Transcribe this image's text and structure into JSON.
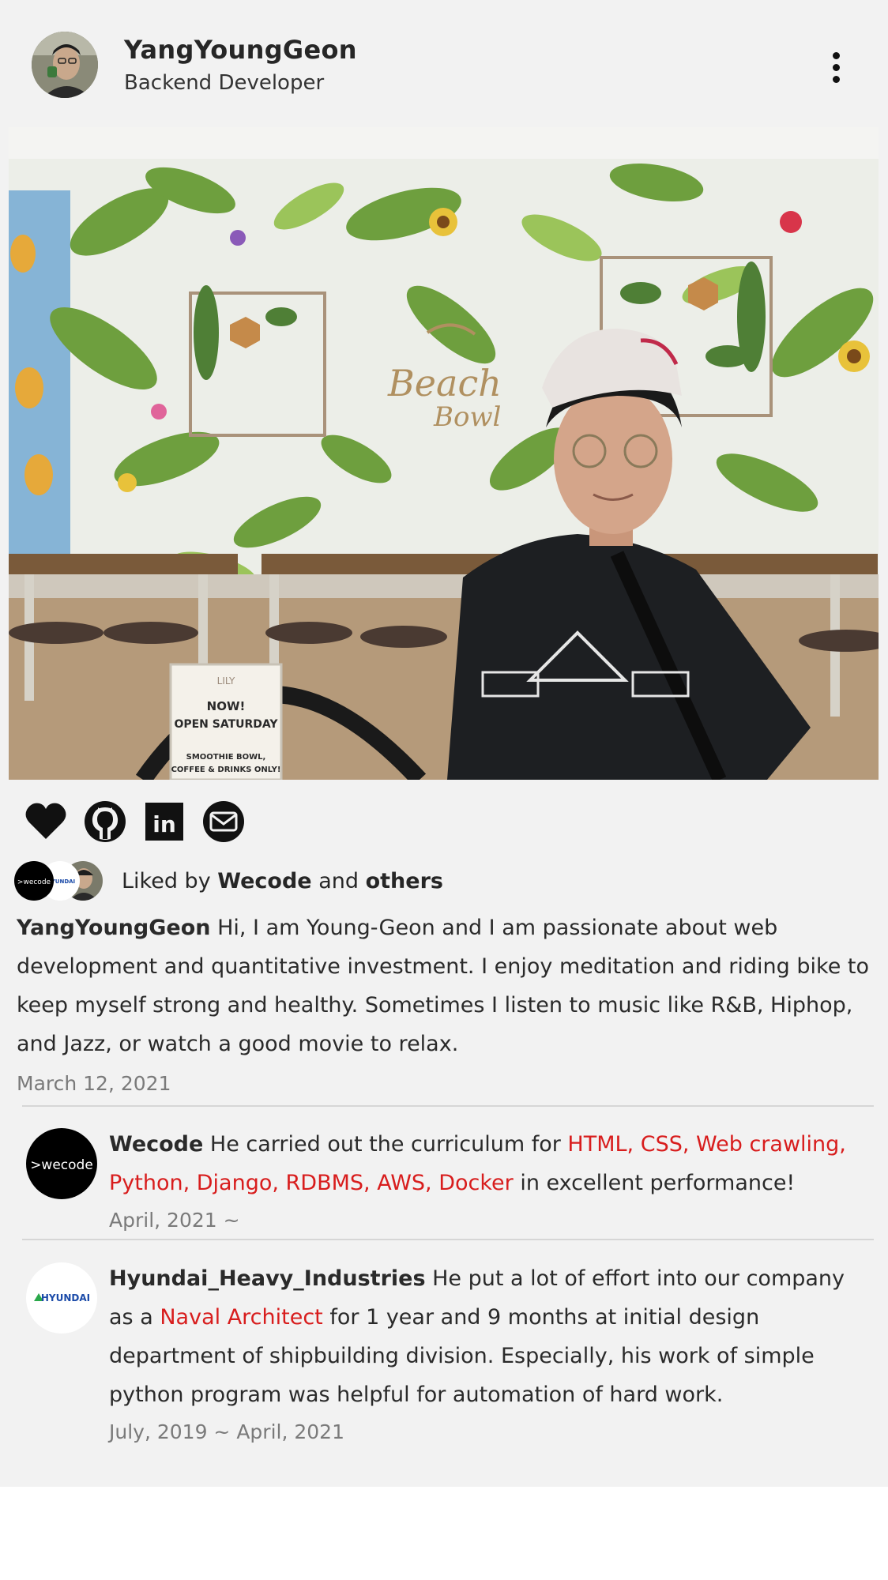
{
  "profile": {
    "name": "YangYoungGeon",
    "role": "Backend Developer"
  },
  "photo": {
    "sign_lines": [
      "LILY",
      "NOW!",
      "OPEN SATURDAY",
      "SMOOTHIE BOWL,",
      "COFFEE & DRINKS ONLY!"
    ],
    "mural_text": [
      "Beach",
      "Bowl"
    ]
  },
  "actions": {
    "icons": [
      "heart-icon",
      "github-icon",
      "linkedin-icon",
      "mail-icon"
    ],
    "linkedin_glyph": "in"
  },
  "liked": {
    "prefix": "Liked by",
    "first": "Wecode",
    "middle": "and",
    "last": "others",
    "avatar_labels": [
      ">wecode",
      "HYUNDAI"
    ]
  },
  "bio": {
    "author": "YangYoungGeon",
    "text": "Hi, I am Young-Geon and I am passionate about web development and quantitative investment. I enjoy meditation and riding bike to keep myself strong and healthy. Sometimes I listen to music like R&B, Hiphop, and Jazz, or watch a good movie to relax.",
    "date": "March 12, 2021"
  },
  "comments": [
    {
      "author": "Wecode",
      "avatar_text": ">wecode",
      "text_before": "He carried out the curriculum for",
      "highlight": "HTML, CSS, Web crawling, Python, Django, RDBMS, AWS, Docker",
      "text_after": "in excellent performance!",
      "date": "April, 2021 ~"
    },
    {
      "author": "Hyundai_Heavy_Industries",
      "avatar_text": "HYUNDAI",
      "text_before": "He put a lot of effort into our company as a",
      "highlight": "Naval Architect",
      "text_after": "for 1 year and 9 months at initial design department of shipbuilding division. Especially, his work of simple python program was helpful for automation of hard work.",
      "date": "July, 2019 ~ April, 2021"
    }
  ],
  "colors": {
    "background": "#f2f2f2",
    "highlight": "#d81d1d",
    "muted": "#7a7a7a"
  }
}
